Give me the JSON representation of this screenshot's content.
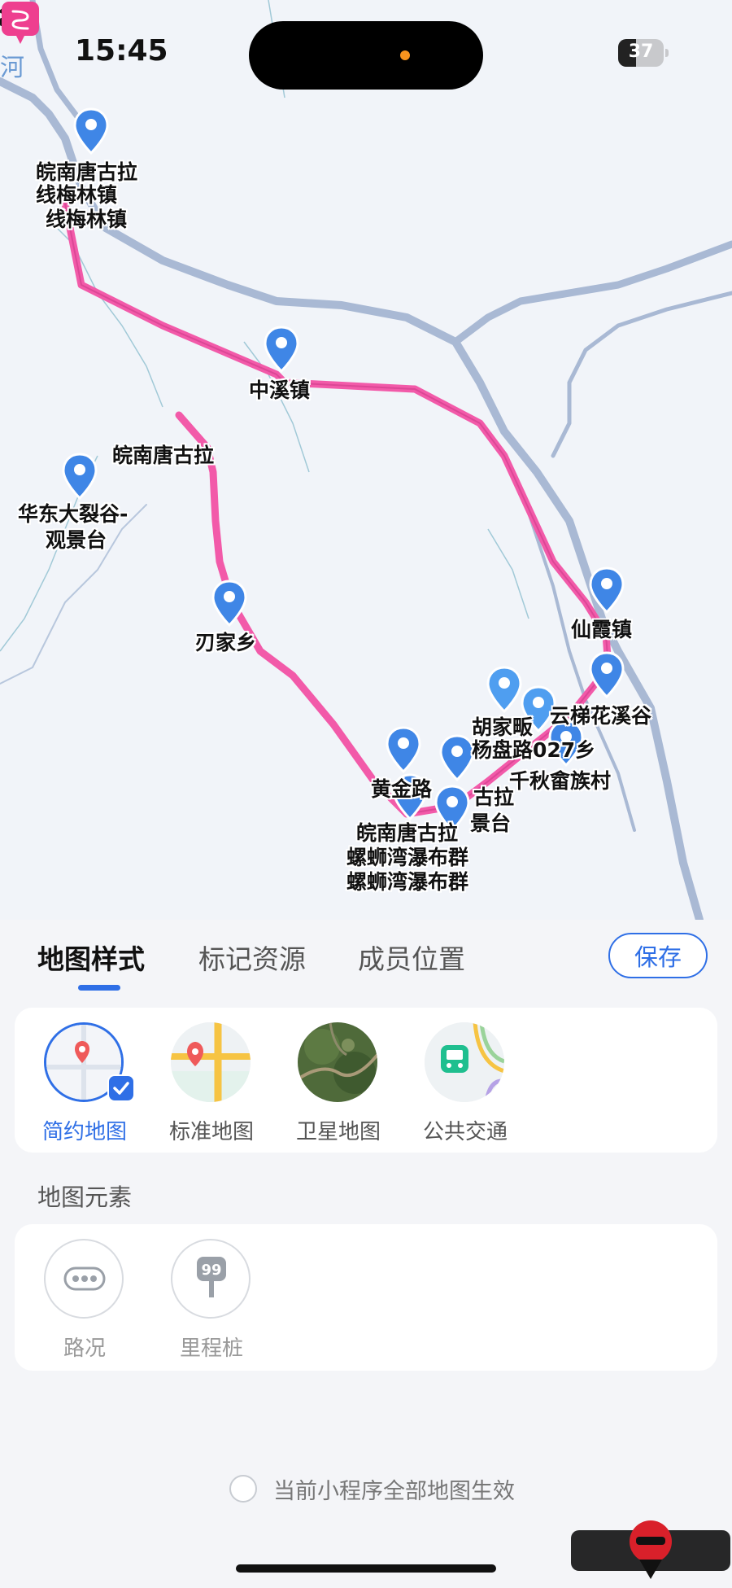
{
  "status_bar": {
    "time": "15:45",
    "battery": "37"
  },
  "map": {
    "river_label": "河",
    "places": [
      {
        "name": "皖南唐古拉线梅林镇",
        "lines": [
          "皖南唐古拉",
          "线梅林镇",
          "线梅林镇"
        ]
      },
      {
        "name": "中溪镇"
      },
      {
        "name": "皖南唐古拉 (路线起点)"
      },
      {
        "name": "华东大裂谷-观景台",
        "lines": [
          "华东大裂谷-",
          "观景台"
        ]
      },
      {
        "name": "刃家乡"
      },
      {
        "name": "仙霞镇"
      },
      {
        "name": "云梯花溪谷"
      },
      {
        "name": "胡家畈"
      },
      {
        "name": "杨盘路027乡"
      },
      {
        "name": "千秋畲族村"
      },
      {
        "name": "黄金路"
      },
      {
        "name": "古拉景台"
      },
      {
        "name": "皖南唐古拉螺蛳湾瀑布群",
        "lines": [
          "皖南唐古拉",
          "螺蛳湾瀑布群",
          "螺蛳湾瀑布群"
        ]
      }
    ],
    "labels": {
      "meilin_1": "皖南唐古拉",
      "meilin_2": "线梅林镇",
      "meilin_3": "线梅林镇",
      "zhongxi": "中溪镇",
      "start": "皖南唐古拉",
      "dalie_1": "华东大裂谷-",
      "dalie_2": "观景台",
      "renjia": "刃家乡",
      "xianxia": "仙霞镇",
      "yunti": "云梯花溪谷",
      "hujia": "胡家畈",
      "yangpan": "杨盘路027乡",
      "qianqiu": "千秋畲族村",
      "huangjin": "黄金路",
      "gula": "古拉",
      "jingtai": "景台",
      "luoshi_1": "皖南唐古拉",
      "luoshi_2": "螺蛳湾瀑布群",
      "luoshi_3": "螺蛳湾瀑布群"
    },
    "route_color": "#f25aa9",
    "river_color": "#a9b9d4",
    "pin_color": "#3f86e6"
  },
  "panel": {
    "tabs": [
      {
        "label": "地图样式",
        "active": true
      },
      {
        "label": "标记资源",
        "active": false
      },
      {
        "label": "成员位置",
        "active": false
      }
    ],
    "save_label": "保存",
    "map_styles": [
      {
        "label": "简约地图",
        "icon": "simple-map-icon",
        "selected": true
      },
      {
        "label": "标准地图",
        "icon": "standard-map-icon",
        "selected": false
      },
      {
        "label": "卫星地图",
        "icon": "satellite-map-icon",
        "selected": false
      },
      {
        "label": "公共交通",
        "icon": "transit-map-icon",
        "selected": false
      }
    ],
    "elements_title": "地图元素",
    "elements": [
      {
        "label": "路况",
        "icon": "traffic-icon"
      },
      {
        "label": "里程桩",
        "icon": "milestone-icon"
      }
    ],
    "apply_all_label": "当前小程序全部地图生效",
    "apply_all_checked": false,
    "accent_color": "#2f6fe6"
  }
}
